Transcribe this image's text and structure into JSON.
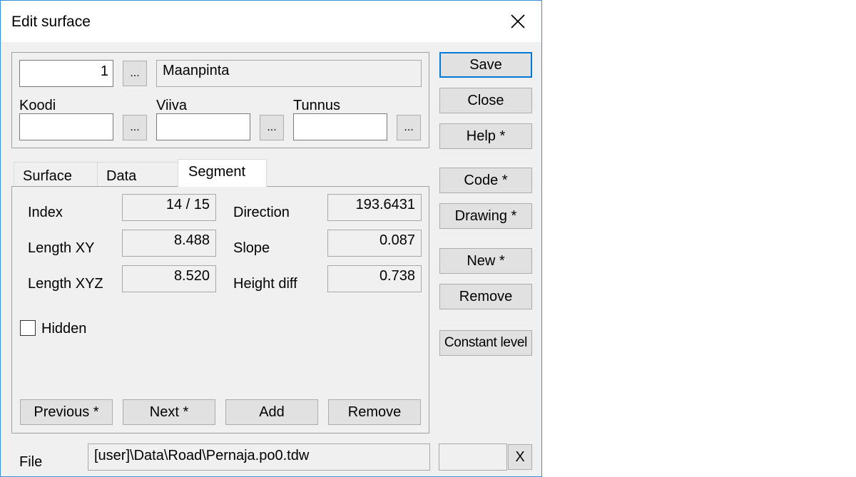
{
  "window": {
    "title": "Edit surface",
    "close_icon": "close-icon"
  },
  "header": {
    "number_value": "1",
    "name_value": "Maanpinta",
    "browse_label": "...",
    "koodi_label": "Koodi",
    "koodi_value": "",
    "viiva_label": "Viiva",
    "viiva_value": "",
    "tunnus_label": "Tunnus",
    "tunnus_value": ""
  },
  "tabs": [
    {
      "label": "Surface",
      "active": false
    },
    {
      "label": "Data",
      "active": false
    },
    {
      "label": "Segment",
      "active": true
    }
  ],
  "segment": {
    "index_label": "Index",
    "index_value": "14 / 15",
    "length_xy_label": "Length XY",
    "length_xy_value": "8.488",
    "length_xyz_label": "Length XYZ",
    "length_xyz_value": "8.520",
    "direction_label": "Direction",
    "direction_value": "193.6431",
    "slope_label": "Slope",
    "slope_value": "0.087",
    "height_diff_label": "Height diff",
    "height_diff_value": "0.738",
    "hidden_label": "Hidden",
    "hidden_checked": false,
    "buttons": {
      "previous": "Previous *",
      "next": "Next *",
      "add": "Add",
      "remove": "Remove"
    }
  },
  "side_buttons": {
    "save": "Save",
    "close": "Close",
    "help": "Help *",
    "code": "Code *",
    "drawing": "Drawing *",
    "new": "New *",
    "remove": "Remove",
    "constant_level": "Constant level"
  },
  "file": {
    "label": "File",
    "path": "[user]\\Data\\Road\\Pernaja.po0.tdw",
    "extra_value": "",
    "clear_label": "X"
  },
  "colors": {
    "accent": "#0078d7",
    "window_border": "#3c8fd6",
    "dialog_bg": "#f0f0f0",
    "button_bg": "#e1e1e1"
  }
}
